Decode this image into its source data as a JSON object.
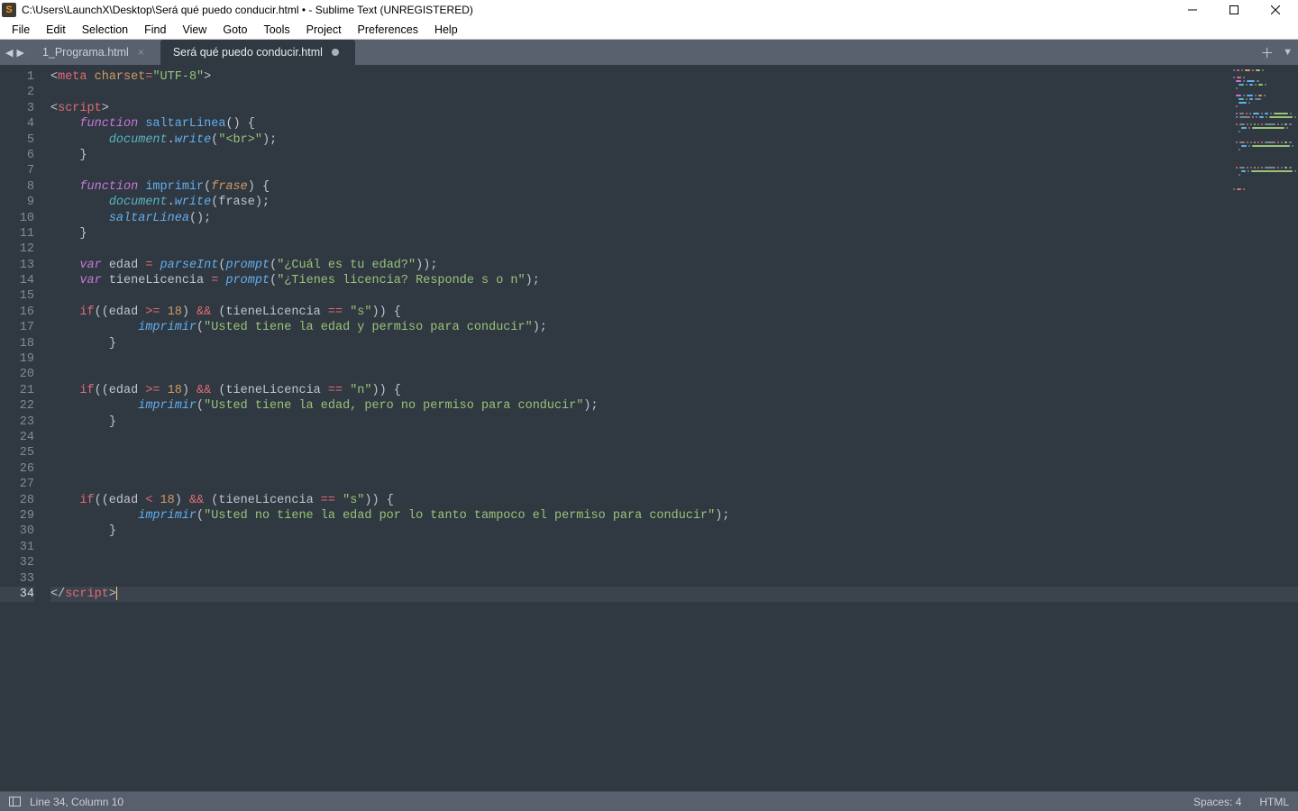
{
  "title": "C:\\Users\\LaunchX\\Desktop\\Será qué puedo conducir.html • - Sublime Text (UNREGISTERED)",
  "menu": [
    "File",
    "Edit",
    "Selection",
    "Find",
    "View",
    "Goto",
    "Tools",
    "Project",
    "Preferences",
    "Help"
  ],
  "tabs": [
    {
      "label": "1_Programa.html",
      "active": false,
      "dirty": false
    },
    {
      "label": "Será qué puedo conducir.html",
      "active": true,
      "dirty": true
    }
  ],
  "line_count": 34,
  "current_line": 34,
  "status": {
    "position": "Line 34, Column 10",
    "spaces": "Spaces: 4",
    "syntax": "HTML"
  },
  "code": [
    {
      "indent": 0,
      "tokens": [
        [
          "t-punc",
          "<"
        ],
        [
          "t-tag",
          "meta"
        ],
        [
          "t-punc",
          " "
        ],
        [
          "t-attr",
          "charset"
        ],
        [
          "t-op",
          "="
        ],
        [
          "t-str",
          "\"UTF-8\""
        ],
        [
          "t-punc",
          ">"
        ]
      ]
    },
    {
      "indent": 0,
      "tokens": []
    },
    {
      "indent": 0,
      "tokens": [
        [
          "t-punc",
          "<"
        ],
        [
          "t-tag",
          "script"
        ],
        [
          "t-punc",
          ">"
        ]
      ]
    },
    {
      "indent": 1,
      "tokens": [
        [
          "t-kw",
          "function"
        ],
        [
          "t-punc",
          " "
        ],
        [
          "t-func",
          "saltarLinea"
        ],
        [
          "t-punc",
          "() {"
        ]
      ]
    },
    {
      "indent": 2,
      "tokens": [
        [
          "t-cyan",
          "document"
        ],
        [
          "t-punc",
          "."
        ],
        [
          "t-funcit",
          "write"
        ],
        [
          "t-punc",
          "("
        ],
        [
          "t-str",
          "\"<br>\""
        ],
        [
          "t-punc",
          ");"
        ]
      ]
    },
    {
      "indent": 1,
      "tokens": [
        [
          "t-punc",
          "}"
        ]
      ]
    },
    {
      "indent": 0,
      "tokens": []
    },
    {
      "indent": 1,
      "tokens": [
        [
          "t-kw",
          "function"
        ],
        [
          "t-punc",
          " "
        ],
        [
          "t-func",
          "imprimir"
        ],
        [
          "t-punc",
          "("
        ],
        [
          "t-param",
          "frase"
        ],
        [
          "t-punc",
          ") {"
        ]
      ]
    },
    {
      "indent": 2,
      "tokens": [
        [
          "t-cyan",
          "document"
        ],
        [
          "t-punc",
          "."
        ],
        [
          "t-funcit",
          "write"
        ],
        [
          "t-punc",
          "(frase);"
        ]
      ]
    },
    {
      "indent": 2,
      "tokens": [
        [
          "t-funcit",
          "saltarLinea"
        ],
        [
          "t-punc",
          "();"
        ]
      ]
    },
    {
      "indent": 1,
      "tokens": [
        [
          "t-punc",
          "}"
        ]
      ]
    },
    {
      "indent": 0,
      "tokens": []
    },
    {
      "indent": 1,
      "tokens": [
        [
          "t-kw",
          "var"
        ],
        [
          "t-punc",
          " edad "
        ],
        [
          "t-op",
          "="
        ],
        [
          "t-punc",
          " "
        ],
        [
          "t-funcit",
          "parseInt"
        ],
        [
          "t-punc",
          "("
        ],
        [
          "t-funcit",
          "prompt"
        ],
        [
          "t-punc",
          "("
        ],
        [
          "t-str",
          "\"¿Cuál es tu edad?\""
        ],
        [
          "t-punc",
          "));"
        ]
      ]
    },
    {
      "indent": 1,
      "tokens": [
        [
          "t-kw",
          "var"
        ],
        [
          "t-punc",
          " tieneLicencia "
        ],
        [
          "t-op",
          "="
        ],
        [
          "t-punc",
          " "
        ],
        [
          "t-funcit",
          "prompt"
        ],
        [
          "t-punc",
          "("
        ],
        [
          "t-str",
          "\"¿Tienes licencia? Responde s o n\""
        ],
        [
          "t-punc",
          ");"
        ]
      ]
    },
    {
      "indent": 0,
      "tokens": []
    },
    {
      "indent": 1,
      "tokens": [
        [
          "t-op",
          "if"
        ],
        [
          "t-punc",
          "((edad "
        ],
        [
          "t-op",
          ">="
        ],
        [
          "t-punc",
          " "
        ],
        [
          "t-num",
          "18"
        ],
        [
          "t-punc",
          ") "
        ],
        [
          "t-op",
          "&&"
        ],
        [
          "t-punc",
          " (tieneLicencia "
        ],
        [
          "t-op",
          "=="
        ],
        [
          "t-punc",
          " "
        ],
        [
          "t-str",
          "\"s\""
        ],
        [
          "t-punc",
          ")) {"
        ]
      ]
    },
    {
      "indent": 3,
      "tokens": [
        [
          "t-funcit",
          "imprimir"
        ],
        [
          "t-punc",
          "("
        ],
        [
          "t-str",
          "\"Usted tiene la edad y permiso para conducir\""
        ],
        [
          "t-punc",
          ");"
        ]
      ]
    },
    {
      "indent": 2,
      "tokens": [
        [
          "t-punc",
          "}"
        ]
      ]
    },
    {
      "indent": 0,
      "tokens": []
    },
    {
      "indent": 0,
      "tokens": []
    },
    {
      "indent": 1,
      "tokens": [
        [
          "t-op",
          "if"
        ],
        [
          "t-punc",
          "((edad "
        ],
        [
          "t-op",
          ">="
        ],
        [
          "t-punc",
          " "
        ],
        [
          "t-num",
          "18"
        ],
        [
          "t-punc",
          ") "
        ],
        [
          "t-op",
          "&&"
        ],
        [
          "t-punc",
          " (tieneLicencia "
        ],
        [
          "t-op",
          "=="
        ],
        [
          "t-punc",
          " "
        ],
        [
          "t-str",
          "\"n\""
        ],
        [
          "t-punc",
          ")) {"
        ]
      ]
    },
    {
      "indent": 3,
      "tokens": [
        [
          "t-funcit",
          "imprimir"
        ],
        [
          "t-punc",
          "("
        ],
        [
          "t-str",
          "\"Usted tiene la edad, pero no permiso para conducir\""
        ],
        [
          "t-punc",
          ");"
        ]
      ]
    },
    {
      "indent": 2,
      "tokens": [
        [
          "t-punc",
          "}"
        ]
      ]
    },
    {
      "indent": 0,
      "tokens": []
    },
    {
      "indent": 0,
      "tokens": []
    },
    {
      "indent": 0,
      "tokens": []
    },
    {
      "indent": 0,
      "tokens": []
    },
    {
      "indent": 1,
      "tokens": [
        [
          "t-op",
          "if"
        ],
        [
          "t-punc",
          "((edad "
        ],
        [
          "t-op",
          "<"
        ],
        [
          "t-punc",
          " "
        ],
        [
          "t-num",
          "18"
        ],
        [
          "t-punc",
          ") "
        ],
        [
          "t-op",
          "&&"
        ],
        [
          "t-punc",
          " (tieneLicencia "
        ],
        [
          "t-op",
          "=="
        ],
        [
          "t-punc",
          " "
        ],
        [
          "t-str",
          "\"s\""
        ],
        [
          "t-punc",
          ")) {"
        ]
      ]
    },
    {
      "indent": 3,
      "tokens": [
        [
          "t-funcit",
          "imprimir"
        ],
        [
          "t-punc",
          "("
        ],
        [
          "t-str",
          "\"Usted no tiene la edad por lo tanto tampoco el permiso para conducir\""
        ],
        [
          "t-punc",
          ");"
        ]
      ]
    },
    {
      "indent": 2,
      "tokens": [
        [
          "t-punc",
          "}"
        ]
      ]
    },
    {
      "indent": 0,
      "tokens": []
    },
    {
      "indent": 0,
      "tokens": []
    },
    {
      "indent": 0,
      "tokens": []
    },
    {
      "indent": 0,
      "tokens": [
        [
          "t-punc",
          "</"
        ],
        [
          "t-tag",
          "script"
        ],
        [
          "t-punc",
          ">"
        ]
      ]
    }
  ]
}
